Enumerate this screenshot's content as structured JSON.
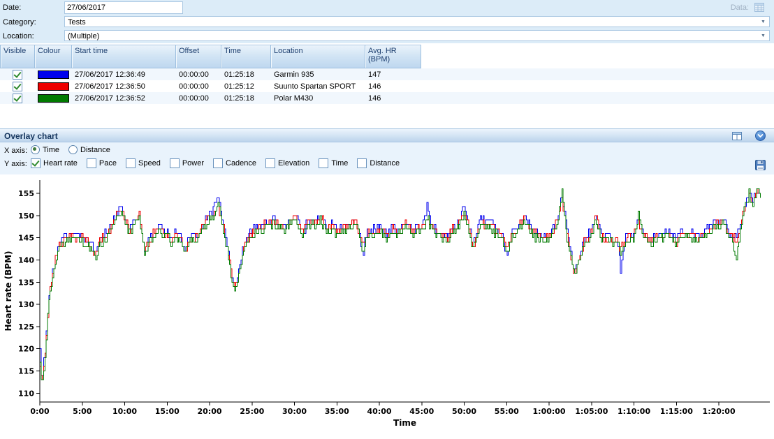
{
  "form": {
    "date_label": "Date:",
    "date_value": "27/06/2017",
    "category_label": "Category:",
    "category_value": "Tests",
    "location_label": "Location:",
    "location_value": "(Multiple)",
    "data_label": "Data:"
  },
  "table": {
    "columns": [
      "Visible",
      "Colour",
      "Start time",
      "Offset",
      "Time",
      "Location",
      "Avg. HR (BPM)"
    ],
    "rows": [
      {
        "visible": true,
        "colour": "#0000ee",
        "start_time": "27/06/2017 12:36:49",
        "offset": "00:00:00",
        "time": "01:25:18",
        "location": "Garmin 935",
        "avg_hr": "147"
      },
      {
        "visible": true,
        "colour": "#ee0000",
        "start_time": "27/06/2017 12:36:50",
        "offset": "00:00:00",
        "time": "01:25:12",
        "location": "Suunto Spartan SPORT",
        "avg_hr": "146"
      },
      {
        "visible": true,
        "colour": "#007a00",
        "start_time": "27/06/2017 12:36:52",
        "offset": "00:00:00",
        "time": "01:25:18",
        "location": "Polar M430",
        "avg_hr": "146"
      }
    ]
  },
  "overlay": {
    "title": "Overlay chart",
    "x_axis_label": "X axis:",
    "x_options": [
      {
        "label": "Time",
        "selected": true
      },
      {
        "label": "Distance",
        "selected": false
      }
    ],
    "y_axis_label": "Y axis:",
    "y_options": [
      {
        "label": "Heart rate",
        "checked": true
      },
      {
        "label": "Pace",
        "checked": false
      },
      {
        "label": "Speed",
        "checked": false
      },
      {
        "label": "Power",
        "checked": false
      },
      {
        "label": "Cadence",
        "checked": false
      },
      {
        "label": "Elevation",
        "checked": false
      },
      {
        "label": "Time",
        "checked": false
      },
      {
        "label": "Distance",
        "checked": false
      }
    ]
  },
  "chart_data": {
    "type": "line",
    "title": "",
    "xlabel": "Time",
    "ylabel": "Heart rate (BPM)",
    "xlim_minutes": [
      0,
      86
    ],
    "ylim": [
      108,
      158
    ],
    "y_ticks": [
      110,
      115,
      120,
      125,
      130,
      135,
      140,
      145,
      150,
      155
    ],
    "x_ticks_minutes": [
      0,
      5,
      10,
      15,
      20,
      25,
      30,
      35,
      40,
      45,
      50,
      55,
      60,
      65,
      70,
      75,
      80
    ],
    "x_tick_labels": [
      "0:00",
      "5:00",
      "10:00",
      "15:00",
      "20:00",
      "25:00",
      "30:00",
      "35:00",
      "40:00",
      "45:00",
      "50:00",
      "55:00",
      "1:00:00",
      "1:05:00",
      "1:10:00",
      "1:15:00",
      "1:20:00"
    ],
    "grid": false,
    "legend": "none",
    "jitter_bpm": 0.9,
    "base_points": [
      [
        0,
        117
      ],
      [
        0.2,
        112
      ],
      [
        0.6,
        119
      ],
      [
        1,
        130
      ],
      [
        1.5,
        137
      ],
      [
        2,
        142
      ],
      [
        2.5,
        144
      ],
      [
        3,
        145
      ],
      [
        4,
        145
      ],
      [
        5,
        145
      ],
      [
        5.5,
        144
      ],
      [
        6,
        143
      ],
      [
        6.5,
        141
      ],
      [
        7,
        144
      ],
      [
        7.5,
        145
      ],
      [
        8,
        146
      ],
      [
        8.5,
        148
      ],
      [
        9,
        150
      ],
      [
        9.5,
        152
      ],
      [
        10,
        149
      ],
      [
        10.5,
        147
      ],
      [
        11,
        148
      ],
      [
        11.7,
        150
      ],
      [
        12.3,
        142
      ],
      [
        13,
        145
      ],
      [
        13.5,
        146
      ],
      [
        14,
        147
      ],
      [
        14.5,
        146
      ],
      [
        15,
        146
      ],
      [
        15.5,
        144
      ],
      [
        16,
        146
      ],
      [
        16.5,
        145
      ],
      [
        17,
        142
      ],
      [
        17.5,
        144
      ],
      [
        18,
        145
      ],
      [
        18.5,
        145
      ],
      [
        19,
        147
      ],
      [
        19.7,
        149
      ],
      [
        20.3,
        150
      ],
      [
        21,
        153
      ],
      [
        21.5,
        148
      ],
      [
        22,
        143
      ],
      [
        22.7,
        135
      ],
      [
        23,
        134
      ],
      [
        23.5,
        138
      ],
      [
        24,
        143
      ],
      [
        24.5,
        145
      ],
      [
        25,
        146
      ],
      [
        25.5,
        147
      ],
      [
        26,
        147
      ],
      [
        26.5,
        148
      ],
      [
        27,
        148
      ],
      [
        27.5,
        149
      ],
      [
        28,
        148
      ],
      [
        28.5,
        147
      ],
      [
        29,
        147
      ],
      [
        29.5,
        149
      ],
      [
        30,
        150
      ],
      [
        30.5,
        148
      ],
      [
        31,
        146
      ],
      [
        31.5,
        148
      ],
      [
        32,
        149
      ],
      [
        32.5,
        148
      ],
      [
        33,
        150
      ],
      [
        33.5,
        148
      ],
      [
        34,
        147
      ],
      [
        34.5,
        148
      ],
      [
        35,
        146
      ],
      [
        35.5,
        147
      ],
      [
        36,
        147
      ],
      [
        36.5,
        148
      ],
      [
        37,
        149
      ],
      [
        37.5,
        147
      ],
      [
        38,
        143
      ],
      [
        38.5,
        146
      ],
      [
        39,
        146
      ],
      [
        40,
        147
      ],
      [
        40.5,
        146
      ],
      [
        41,
        145
      ],
      [
        41.5,
        147
      ],
      [
        42,
        146
      ],
      [
        42.5,
        147
      ],
      [
        43,
        148
      ],
      [
        43.5,
        147
      ],
      [
        44,
        146
      ],
      [
        44.5,
        147
      ],
      [
        45,
        147
      ],
      [
        45.7,
        150
      ],
      [
        46,
        148
      ],
      [
        46.5,
        147
      ],
      [
        47,
        146
      ],
      [
        48,
        145
      ],
      [
        48.5,
        147
      ],
      [
        49,
        147
      ],
      [
        49.5,
        149
      ],
      [
        50,
        151
      ],
      [
        50.5,
        148
      ],
      [
        51,
        143
      ],
      [
        51.5,
        146
      ],
      [
        52,
        149
      ],
      [
        52.5,
        148
      ],
      [
        53,
        148
      ],
      [
        53.5,
        147
      ],
      [
        54,
        146
      ],
      [
        54.5,
        145
      ],
      [
        55,
        142
      ],
      [
        55.5,
        145
      ],
      [
        56,
        146
      ],
      [
        56.5,
        148
      ],
      [
        57,
        149
      ],
      [
        57.5,
        148
      ],
      [
        58,
        146
      ],
      [
        59,
        145
      ],
      [
        59.5,
        145
      ],
      [
        60,
        145
      ],
      [
        60.5,
        147
      ],
      [
        61,
        149
      ],
      [
        61.5,
        154
      ],
      [
        62,
        147
      ],
      [
        62.7,
        139
      ],
      [
        63,
        137
      ],
      [
        63.5,
        140
      ],
      [
        64,
        144
      ],
      [
        64.5,
        145
      ],
      [
        65,
        146
      ],
      [
        65.5,
        150
      ],
      [
        66,
        146
      ],
      [
        66.5,
        145
      ],
      [
        67,
        145
      ],
      [
        67.5,
        144
      ],
      [
        68,
        145
      ],
      [
        68.4,
        142
      ],
      [
        69,
        145
      ],
      [
        69.5,
        145
      ],
      [
        70,
        146
      ],
      [
        70.5,
        149
      ],
      [
        71,
        146
      ],
      [
        71.5,
        145
      ],
      [
        72,
        144
      ],
      [
        72.5,
        145
      ],
      [
        73,
        145
      ],
      [
        73.5,
        146
      ],
      [
        74,
        146
      ],
      [
        74.5,
        145
      ],
      [
        75,
        144
      ],
      [
        75.5,
        146
      ],
      [
        76,
        146
      ],
      [
        76.5,
        146
      ],
      [
        77,
        145
      ],
      [
        77.5,
        145
      ],
      [
        78,
        145
      ],
      [
        78.5,
        146
      ],
      [
        79,
        147
      ],
      [
        79.5,
        148
      ],
      [
        80,
        148
      ],
      [
        80.5,
        149
      ],
      [
        81,
        146
      ],
      [
        81.5,
        145
      ],
      [
        82,
        145
      ],
      [
        82.5,
        147
      ],
      [
        83,
        152
      ],
      [
        83.5,
        154
      ],
      [
        84,
        153
      ],
      [
        84.5,
        155
      ],
      [
        85,
        154
      ]
    ],
    "series": [
      {
        "name": "Garmin 935",
        "color": "#0000ee",
        "offset": 0.5,
        "overrides": [
          [
            0,
            119
          ],
          [
            21,
            155
          ],
          [
            38,
            141
          ],
          [
            45.7,
            153
          ],
          [
            50,
            152
          ],
          [
            55,
            140
          ],
          [
            61.5,
            155
          ],
          [
            68.4,
            138
          ],
          [
            84.5,
            156
          ],
          [
            85,
            155
          ]
        ]
      },
      {
        "name": "Suunto Spartan SPORT",
        "color": "#ee0000",
        "offset": 0,
        "overrides": [
          [
            21,
            152
          ],
          [
            55,
            142
          ]
        ]
      },
      {
        "name": "Polar M430",
        "color": "#007a00",
        "offset": -0.6,
        "overrides": [
          [
            0.2,
            111
          ],
          [
            61.5,
            156
          ],
          [
            70.5,
            151
          ],
          [
            82,
            140
          ],
          [
            83.5,
            155
          ],
          [
            84.5,
            156
          ]
        ]
      }
    ]
  }
}
